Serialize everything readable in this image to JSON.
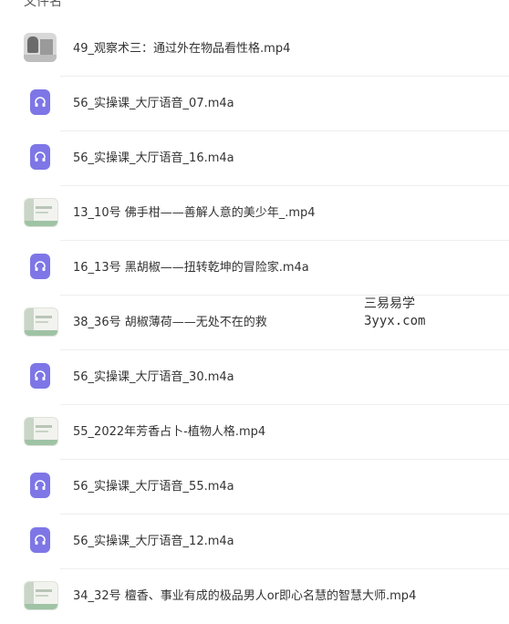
{
  "header": {
    "label": "文件名"
  },
  "files": [
    {
      "name": "49_观察术三：通过外在物品看性格.mp4",
      "thumb": "photo"
    },
    {
      "name": "56_实操课_大厅语音_07.m4a",
      "thumb": "audio"
    },
    {
      "name": "56_实操课_大厅语音_16.m4a",
      "thumb": "audio"
    },
    {
      "name": "13_10号 佛手柑——善解人意的美少年_.mp4",
      "thumb": "video"
    },
    {
      "name": "16_13号 黑胡椒——扭转乾坤的冒险家.m4a",
      "thumb": "audio"
    },
    {
      "name": "38_36号 胡椒薄荷——无处不在的救",
      "thumb": "video"
    },
    {
      "name": "56_实操课_大厅语音_30.m4a",
      "thumb": "audio"
    },
    {
      "name": "55_2022年芳香占卜-植物人格.mp4",
      "thumb": "video"
    },
    {
      "name": "56_实操课_大厅语音_55.m4a",
      "thumb": "audio"
    },
    {
      "name": "56_实操课_大厅语音_12.m4a",
      "thumb": "audio"
    },
    {
      "name": "34_32号 檀香、事业有成的极品男人or即心名慧的智慧大师.mp4",
      "thumb": "video"
    }
  ],
  "watermark": {
    "line1": "三易易学",
    "line2": "3yyx.com"
  }
}
